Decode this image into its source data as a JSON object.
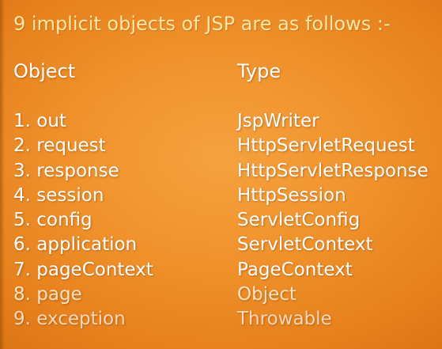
{
  "slide": {
    "title": "9 implicit objects of JSP are as follows :-",
    "headers": {
      "object": "Object",
      "type": "Type"
    },
    "rows": [
      {
        "object": "1. out",
        "type": "JspWriter"
      },
      {
        "object": "2. request",
        "type": "HttpServletRequest"
      },
      {
        "object": "3. response",
        "type": "HttpServletResponse"
      },
      {
        "object": "4. session",
        "type": "HttpSession"
      },
      {
        "object": "5. config",
        "type": "ServletConfig"
      },
      {
        "object": "6. application",
        "type": "ServletContext"
      },
      {
        "object": "7. pageContext",
        "type": "PageContext"
      },
      {
        "object": "8. page",
        "type": "Object"
      },
      {
        "object": "9. exception",
        "type": "Throwable"
      }
    ],
    "colors": {
      "background": "#f0922c",
      "title": "#fde7a6",
      "text": "#ffffff"
    }
  }
}
